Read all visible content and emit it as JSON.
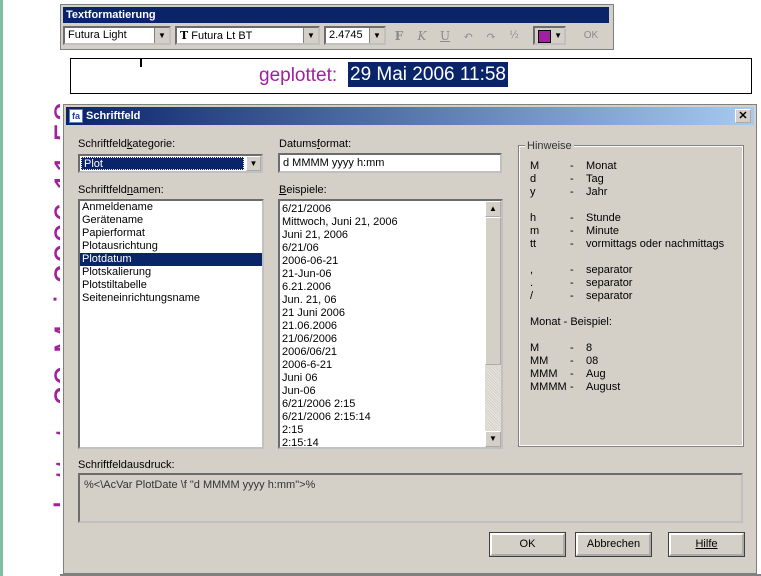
{
  "drawing": {
    "vertical_label": "geplottet: 29 Mai 2006 11:58",
    "edit_label": "geplottet:",
    "edit_selected": "29 Mai 2006 11:58"
  },
  "toolbar": {
    "title": "Textformatierung",
    "style_value": "Futura Light",
    "font_value": "Futura Lt BT",
    "font_prefix": "T",
    "height_value": "2.4745",
    "bold_icon": "bold-icon",
    "italic_icon": "italic-icon",
    "underline_icon": "underline-icon",
    "undo_icon": "undo-icon",
    "redo_icon": "redo-icon",
    "stack_icon": "stack-icon",
    "color": "#a020a0",
    "ok_label": "OK",
    "bold_glyph": "F",
    "italic_glyph": "K",
    "underline_glyph": "U",
    "undo_glyph": "↶",
    "redo_glyph": "↷",
    "stack_glyph": "½"
  },
  "dialog": {
    "title": "Schriftfeld",
    "icon_glyph": "fa",
    "close_glyph": "✕",
    "category_label_pre": "Schriftfeld",
    "category_label_u": "k",
    "category_label_post": "ategorie:",
    "category_value": "Plot",
    "names_label_pre": "Schriftfeld",
    "names_label_u": "n",
    "names_label_post": "amen:",
    "names": [
      "Anmeldename",
      "Gerätename",
      "Papierformat",
      "Plotausrichtung",
      "Plotdatum",
      "Plotskalierung",
      "Plotstiltabelle",
      "Seiteneinrichtungsname"
    ],
    "names_selected_index": 4,
    "format_label_pre": "Datums",
    "format_label_u": "f",
    "format_label_post": "ormat:",
    "format_value": "d MMMM yyyy h:mm",
    "examples_label_pre": "",
    "examples_label_u": "B",
    "examples_label_post": "eispiele:",
    "examples": [
      "6/21/2006",
      "Mittwoch, Juni 21, 2006",
      "Juni 21, 2006",
      "6/21/06",
      "2006-06-21",
      "21-Jun-06",
      "6.21.2006",
      "Jun. 21, 06",
      "21 Juni 2006",
      "21.06.2006",
      "21/06/2006",
      "2006/06/21",
      "2006-6-21",
      "Juni 06",
      "Jun-06",
      "6/21/2006 2:15",
      "6/21/2006 2:15:14",
      "2:15",
      "2:15:14"
    ],
    "scroll_up_glyph": "▲",
    "scroll_down_glyph": "▼",
    "hints_title": "Hinweise",
    "hints": [
      {
        "code": "M",
        "sep": "-",
        "desc": "Monat"
      },
      {
        "code": "d",
        "sep": "-",
        "desc": "Tag"
      },
      {
        "code": "y",
        "sep": "-",
        "desc": "Jahr"
      },
      {
        "code": "",
        "sep": "",
        "desc": ""
      },
      {
        "code": "h",
        "sep": "-",
        "desc": "Stunde"
      },
      {
        "code": "m",
        "sep": "-",
        "desc": "Minute"
      },
      {
        "code": "tt",
        "sep": "-",
        "desc": "vormittags oder nachmittags"
      },
      {
        "code": "",
        "sep": "",
        "desc": ""
      },
      {
        "code": ",",
        "sep": "-",
        "desc": "separator"
      },
      {
        "code": ".",
        "sep": "-",
        "desc": "separator"
      },
      {
        "code": "/",
        "sep": "-",
        "desc": "separator"
      },
      {
        "code": "",
        "sep": "",
        "desc": ""
      },
      {
        "code": "Monat - Beispiel:",
        "sep": "",
        "desc": ""
      },
      {
        "code": "",
        "sep": "",
        "desc": ""
      },
      {
        "code": "M",
        "sep": "-",
        "desc": "8"
      },
      {
        "code": "MM",
        "sep": "-",
        "desc": "08"
      },
      {
        "code": "MMM",
        "sep": "-",
        "desc": "Aug"
      },
      {
        "code": "MMMM",
        "sep": "-",
        "desc": "August"
      }
    ],
    "expr_label": "Schriftfeldausdruck:",
    "expr_value": "%<\\AcVar PlotDate \\f \"d MMMM yyyy h:mm\">%",
    "ok_label": "OK",
    "cancel_label": "Abbrechen",
    "help_label": "Hilfe"
  }
}
